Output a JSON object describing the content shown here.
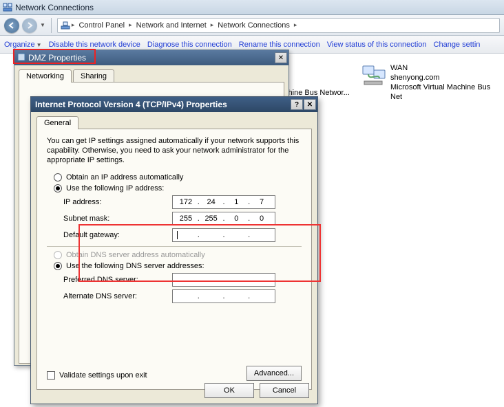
{
  "window": {
    "title": "Network Connections"
  },
  "breadcrumb": {
    "item1": "Control Panel",
    "item2": "Network and Internet",
    "item3": "Network Connections"
  },
  "cmdbar": {
    "organize": "Organize",
    "disable": "Disable this network device",
    "diagnose": "Diagnose this connection",
    "rename": "Rename this connection",
    "viewstatus": "View status of this connection",
    "change": "Change settin"
  },
  "connections": {
    "hidden1_status": "ual Machine Bus Networ...",
    "wan": {
      "name": "WAN",
      "domain": "shenyong.com",
      "adapter": "Microsoft Virtual Machine Bus Net"
    }
  },
  "dmz": {
    "title": "DMZ Properties",
    "tabs": {
      "networking": "Networking",
      "sharing": "Sharing"
    }
  },
  "ipv4": {
    "title": "Internet Protocol Version 4 (TCP/IPv4) Properties",
    "tab": "General",
    "desc": "You can get IP settings assigned automatically if your network supports this capability. Otherwise, you need to ask your network administrator for the appropriate IP settings.",
    "radio_auto_ip": "Obtain an IP address automatically",
    "radio_use_ip": "Use the following IP address:",
    "label_ip": "IP address:",
    "label_mask": "Subnet mask:",
    "label_gateway": "Default gateway:",
    "ip": {
      "o1": "172",
      "o2": "24",
      "o3": "1",
      "o4": "7"
    },
    "mask": {
      "o1": "255",
      "o2": "255",
      "o3": "0",
      "o4": "0"
    },
    "gateway": {
      "o1": "",
      "o2": "",
      "o3": "",
      "o4": ""
    },
    "radio_auto_dns": "Obtain DNS server address automatically",
    "radio_use_dns": "Use the following DNS server addresses:",
    "label_dns1": "Preferred DNS server:",
    "label_dns2": "Alternate DNS server:",
    "dns1": {
      "o1": "",
      "o2": "",
      "o3": "",
      "o4": ""
    },
    "dns2": {
      "o1": "",
      "o2": "",
      "o3": "",
      "o4": ""
    },
    "validate": "Validate settings upon exit",
    "advanced": "Advanced...",
    "ok": "OK",
    "cancel": "Cancel"
  }
}
